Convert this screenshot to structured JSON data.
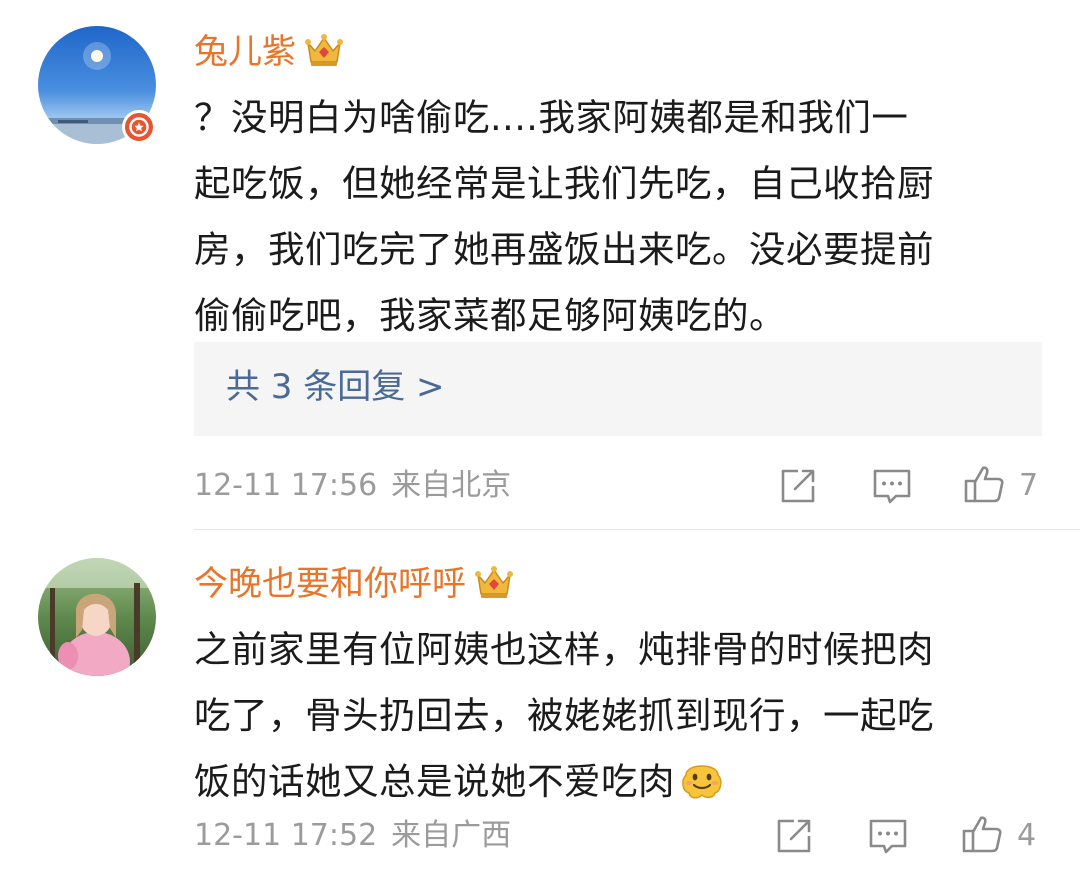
{
  "comments": [
    {
      "username": "兔儿紫",
      "text_lines": [
        "？没明白为啥偷吃....我家阿姨都是和我们一",
        "起吃饭，但她经常是让我们先吃，自己收拾厨",
        "房，我们吃完了她再盛饭出来吃。没必要提前",
        "偷偷吃吧，我家菜都足够阿姨吃的。"
      ],
      "replies_label": "共 3 条回复 >",
      "time": "12-11 17:56",
      "location": "来自北京",
      "likes": "7"
    },
    {
      "username": "今晚也要和你呼呼",
      "text_lines": [
        "之前家里有位阿姨也这样，炖排骨的时候把肉",
        "吃了，骨头扔回去，被姥姥抓到现行，一起吃",
        "饭的话她又总是说她不爱吃肉"
      ],
      "time": "12-11 17:52",
      "location": "来自广西",
      "likes": "4"
    }
  ],
  "icons": {
    "vip_badge": "star-badge-icon",
    "crown": "crown-icon",
    "emoji": "smile-emoji-icon",
    "share": "share-icon",
    "comment": "comment-icon",
    "like": "thumbs-up-icon"
  },
  "colors": {
    "username": "#e8752a",
    "body_text": "#1b1b1b",
    "reply_link": "#4a6996",
    "meta": "#9b9b9b",
    "reply_bg": "#f5f5f5"
  }
}
